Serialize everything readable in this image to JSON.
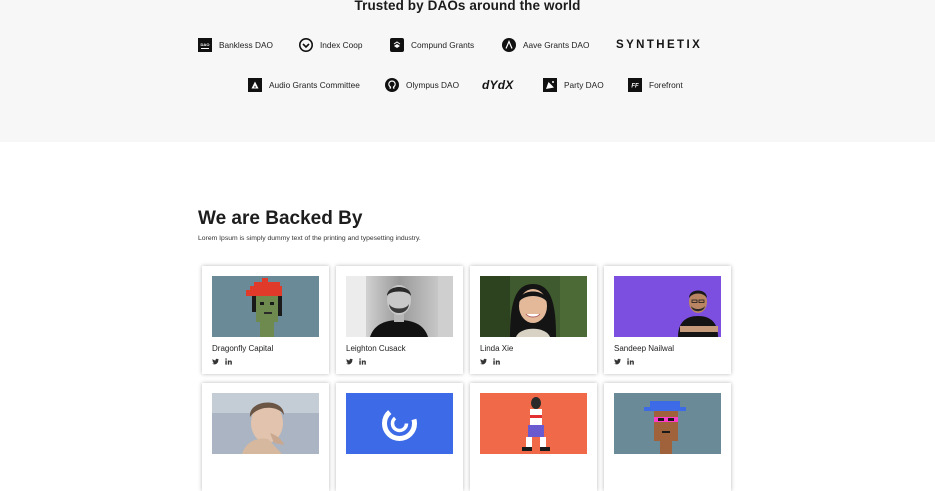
{
  "trusted": {
    "title": "Trusted by DAOs around the world",
    "logos": [
      {
        "name": "Bankless DAO",
        "icon": "bankless-dao-icon"
      },
      {
        "name": "Index Coop",
        "icon": "index-coop-icon"
      },
      {
        "name": "Compund Grants",
        "icon": "compound-icon"
      },
      {
        "name": "Aave Grants DAO",
        "icon": "aave-icon"
      },
      {
        "name": "SYNTHETIX",
        "icon": "synthetix-wordmark"
      },
      {
        "name": "Audio Grants Committee",
        "icon": "audius-icon"
      },
      {
        "name": "Olympus DAO",
        "icon": "olympus-icon"
      },
      {
        "name": "dYdX",
        "icon": "dydx-wordmark"
      },
      {
        "name": "Party DAO",
        "icon": "party-dao-icon"
      },
      {
        "name": "Forefront",
        "icon": "forefront-icon"
      }
    ]
  },
  "backed": {
    "title": "We are Backed By",
    "subtitle": "Lorem Ipsum is simply dummy text of the printing and typesetting industry.",
    "backers": [
      {
        "name": "Dragonfly Capital",
        "photo": "pixel-punk-red-hair"
      },
      {
        "name": "Leighton Cusack",
        "photo": "bw-portrait-bearded-man"
      },
      {
        "name": "Linda Xie",
        "photo": "portrait-woman"
      },
      {
        "name": "Sandeep Nailwal",
        "photo": "portrait-man-purple-bg"
      },
      {
        "name": "",
        "photo": "portrait-man-hand-chin"
      },
      {
        "name": "",
        "photo": "swirl-logo-blue"
      },
      {
        "name": "",
        "photo": "figure-orange-bg"
      },
      {
        "name": "",
        "photo": "pixel-punk-blue-cap"
      }
    ],
    "social_icons": [
      "twitter-icon",
      "linkedin-icon"
    ],
    "colors": {
      "purple": "#7d4fe0",
      "blue": "#3d6be8",
      "orange": "#f06a4a",
      "slate": "#6a8a97"
    }
  }
}
